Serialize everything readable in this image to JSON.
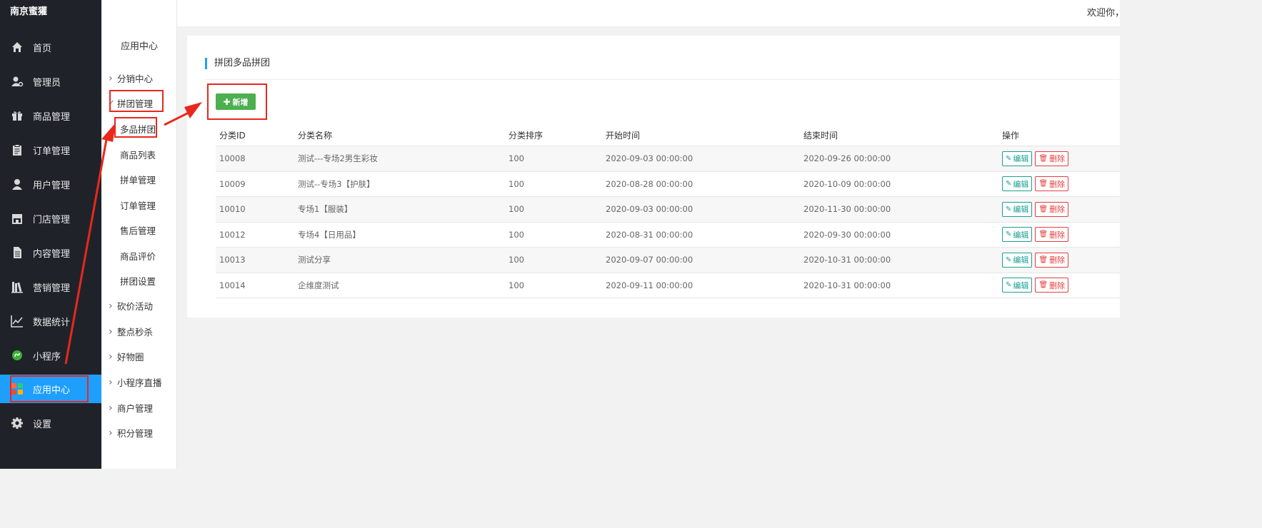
{
  "sidebar": {
    "brand": "南京蜜獾",
    "items": [
      {
        "label": "首页",
        "icon": "home-icon"
      },
      {
        "label": "管理员",
        "icon": "admin-user-icon"
      },
      {
        "label": "商品管理",
        "icon": "gift-icon"
      },
      {
        "label": "订单管理",
        "icon": "clipboard-icon"
      },
      {
        "label": "用户管理",
        "icon": "user-icon"
      },
      {
        "label": "门店管理",
        "icon": "store-icon"
      },
      {
        "label": "内容管理",
        "icon": "document-icon"
      },
      {
        "label": "营销管理",
        "icon": "books-icon"
      },
      {
        "label": "数据统计",
        "icon": "line-chart-icon"
      },
      {
        "label": "小程序",
        "icon": "mini-program-icon"
      },
      {
        "label": "应用中心",
        "icon": "app-grid-icon",
        "active": true
      },
      {
        "label": "设置",
        "icon": "gear-icon"
      }
    ]
  },
  "submenu": {
    "title": "应用中心",
    "groups": [
      {
        "label": "分销中心",
        "expanded": false
      },
      {
        "label": "拼团管理",
        "expanded": true
      },
      {
        "label": "砍价活动",
        "expanded": false
      },
      {
        "label": "整点秒杀",
        "expanded": false
      },
      {
        "label": "好物圈",
        "expanded": false
      },
      {
        "label": "小程序直播",
        "expanded": false
      },
      {
        "label": "商户管理",
        "expanded": false
      },
      {
        "label": "积分管理",
        "expanded": false
      }
    ],
    "items": [
      "多品拼团",
      "商品列表",
      "拼单管理",
      "订单管理",
      "售后管理",
      "商品评价",
      "拼团设置"
    ]
  },
  "topbar": {
    "welcome": "欢迎你，",
    "collapse_icon": "menu-collapse-icon",
    "refresh_icon": "refresh-icon"
  },
  "main": {
    "title": "拼团多品拼团",
    "add_button": "新增"
  },
  "table": {
    "columns": [
      "分类ID",
      "分类名称",
      "分类排序",
      "开始时间",
      "结束时间",
      "操作"
    ],
    "rows": [
      {
        "id": "10008",
        "name": "测试---专场2男生彩妆",
        "sort": "100",
        "start": "2020-09-03 00:00:00",
        "end": "2020-09-26 00:00:00"
      },
      {
        "id": "10009",
        "name": "测试--专场3【护肤】",
        "sort": "100",
        "start": "2020-08-28 00:00:00",
        "end": "2020-10-09 00:00:00"
      },
      {
        "id": "10010",
        "name": "专场1【服装】",
        "sort": "100",
        "start": "2020-09-03 00:00:00",
        "end": "2020-11-30 00:00:00"
      },
      {
        "id": "10012",
        "name": "专场4【日用品】",
        "sort": "100",
        "start": "2020-08-31 00:00:00",
        "end": "2020-09-30 00:00:00"
      },
      {
        "id": "10013",
        "name": "测试分享",
        "sort": "100",
        "start": "2020-09-07 00:00:00",
        "end": "2020-10-31 00:00:00"
      },
      {
        "id": "10014",
        "name": "企维度测试",
        "sort": "100",
        "start": "2020-09-11 00:00:00",
        "end": "2020-10-31 00:00:00"
      }
    ],
    "edit_label": "编辑",
    "delete_label": "删除"
  },
  "colors": {
    "sidebar_bg": "#20222a",
    "active_blue": "#1e9fff",
    "add_green": "#4caf50",
    "edit_teal": "#1aa094",
    "delete_red": "#e43f3f",
    "annotation_red": "#e8281c"
  }
}
